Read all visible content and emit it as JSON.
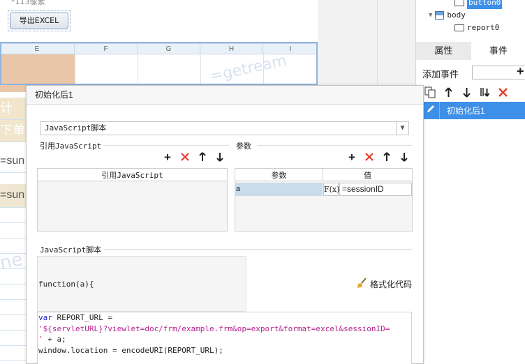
{
  "canvas": {
    "top_note": "*113像素",
    "export_button": "导出EXCEL",
    "columns": [
      "E",
      "F",
      "G",
      "H",
      "I"
    ],
    "side_text": [
      "计",
      "下单",
      "=sun",
      "=sun"
    ],
    "watermark": "=getream"
  },
  "tree": {
    "items": [
      {
        "label": "button0"
      },
      {
        "label": "body"
      },
      {
        "label": "report0"
      }
    ]
  },
  "right_panel": {
    "tabs": [
      "属性",
      "事件"
    ],
    "active_tab": "事件",
    "add_event_label": "添加事件",
    "add_icon": "plus-icon",
    "toolbar_icons": [
      "copy-icon",
      "arrow-up-icon",
      "arrow-down-icon",
      "move-bottom-icon",
      "delete-icon"
    ],
    "events": [
      {
        "label": "初始化后1",
        "icon": "pencil-icon"
      }
    ],
    "accent": "#3d8fe8"
  },
  "dialog": {
    "title": "初始化后1",
    "type_select": "JavaScript脚本",
    "ref_js": {
      "label": "引用JavaScript",
      "column": "引用JavaScript",
      "rows": []
    },
    "params": {
      "label": "参数",
      "columns": [
        "参数",
        "值"
      ],
      "rows": [
        {
          "name": "a",
          "fx": "F(x)",
          "value": "=sessionID"
        }
      ]
    },
    "script_label": "JavaScript脚本",
    "function_head": "function(a){",
    "format_button": "格式化代码",
    "code": {
      "line1_kw": "var",
      "line1_rest": " REPORT_URL =",
      "line2": "'${servletURL}?viewlet=doc/frm/example.frm&op=export&format=excel&sessionID=",
      "line3_str": "'",
      "line3_rest": " + a;",
      "line4": "window.location = encodeURI(REPORT_URL);"
    },
    "delete_color": "#e43b2c"
  }
}
